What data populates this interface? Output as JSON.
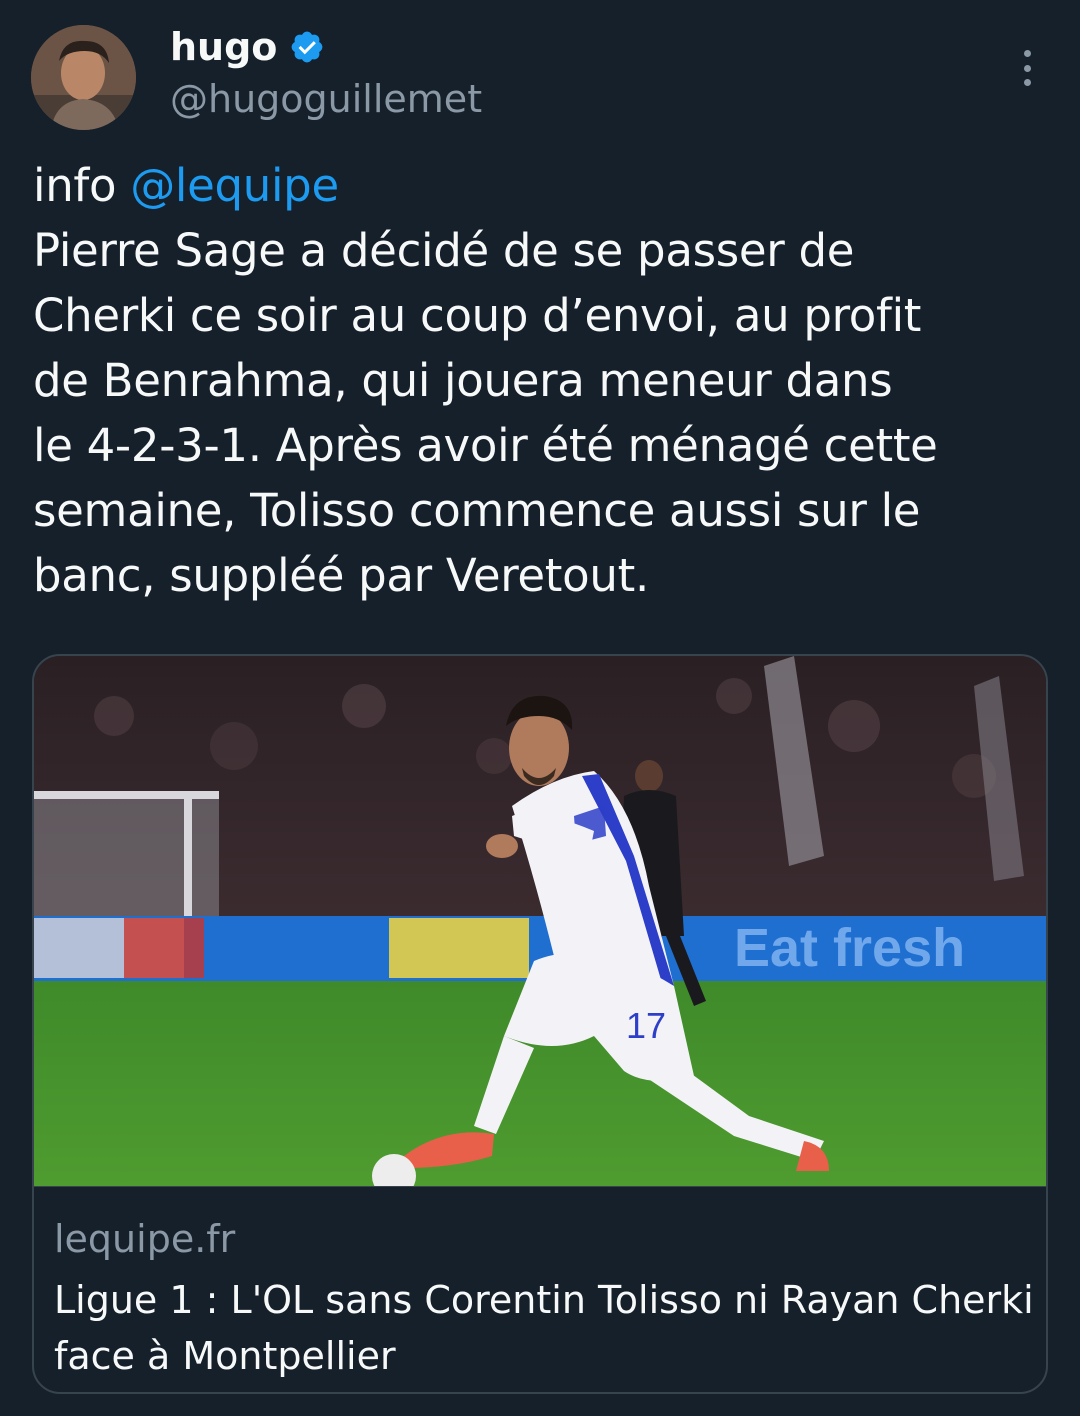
{
  "author": {
    "display_name": "hugo",
    "handle": "@hugoguillemet",
    "verified": true,
    "verified_icon": "verified-badge-icon",
    "avatar_icon": "avatar-photo"
  },
  "tweet": {
    "prefix": "info ",
    "mention": "@lequipe",
    "body": "Pierre Sage a décidé de se passer de\nCherki ce soir au coup d’envoi, au profit\nde Benrahma, qui jouera meneur dans\nle 4-2-3-1. Après avoir été ménagé cette\nsemaine, Tolisso commence aussi sur le\nbanc, suppléé par Veretout."
  },
  "card": {
    "image_icon": "football-player-photo",
    "shirt_number": "17",
    "board_text": "Eat fresh",
    "domain": "lequipe.fr",
    "title": "Ligue 1 : L'OL sans Corentin Tolisso ni Rayan Cherki face à Montpellier"
  },
  "colors": {
    "background": "#15202b",
    "text": "#f7f9f9",
    "secondary": "#8b98a5",
    "accent": "#1d9bf0",
    "border": "#38444d"
  }
}
